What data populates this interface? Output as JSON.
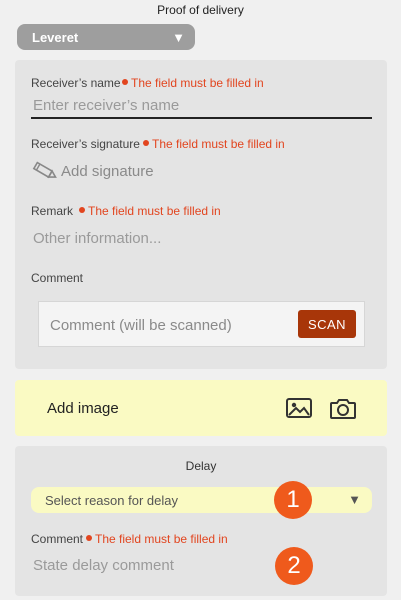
{
  "header": {
    "title": "Proof of delivery"
  },
  "route_select": {
    "value": "Leveret"
  },
  "receiver": {
    "name_label": "Receiver’s name",
    "name_error": "The field must be filled in",
    "name_placeholder": "Enter receiver’s name",
    "signature_label": "Receiver’s signature",
    "signature_error": "The field must be filled in",
    "signature_action": "Add signature",
    "remark_label": "Remark",
    "remark_error": "The field must be filled in",
    "remark_placeholder": "Other information...",
    "comment_label": "Comment",
    "comment_placeholder": "Comment (will be scanned)",
    "scan_label": "SCAN"
  },
  "image_section": {
    "label": "Add image"
  },
  "delay": {
    "title": "Delay",
    "reason_placeholder": "Select reason for delay",
    "comment_label": "Comment",
    "comment_error": "The field must be filled in",
    "comment_placeholder": "State delay comment"
  },
  "badges": [
    "1",
    "2"
  ],
  "colors": {
    "error": "#e2451f",
    "accent": "#a83609",
    "badge": "#ef5a1c",
    "highlight": "#fafac3"
  }
}
